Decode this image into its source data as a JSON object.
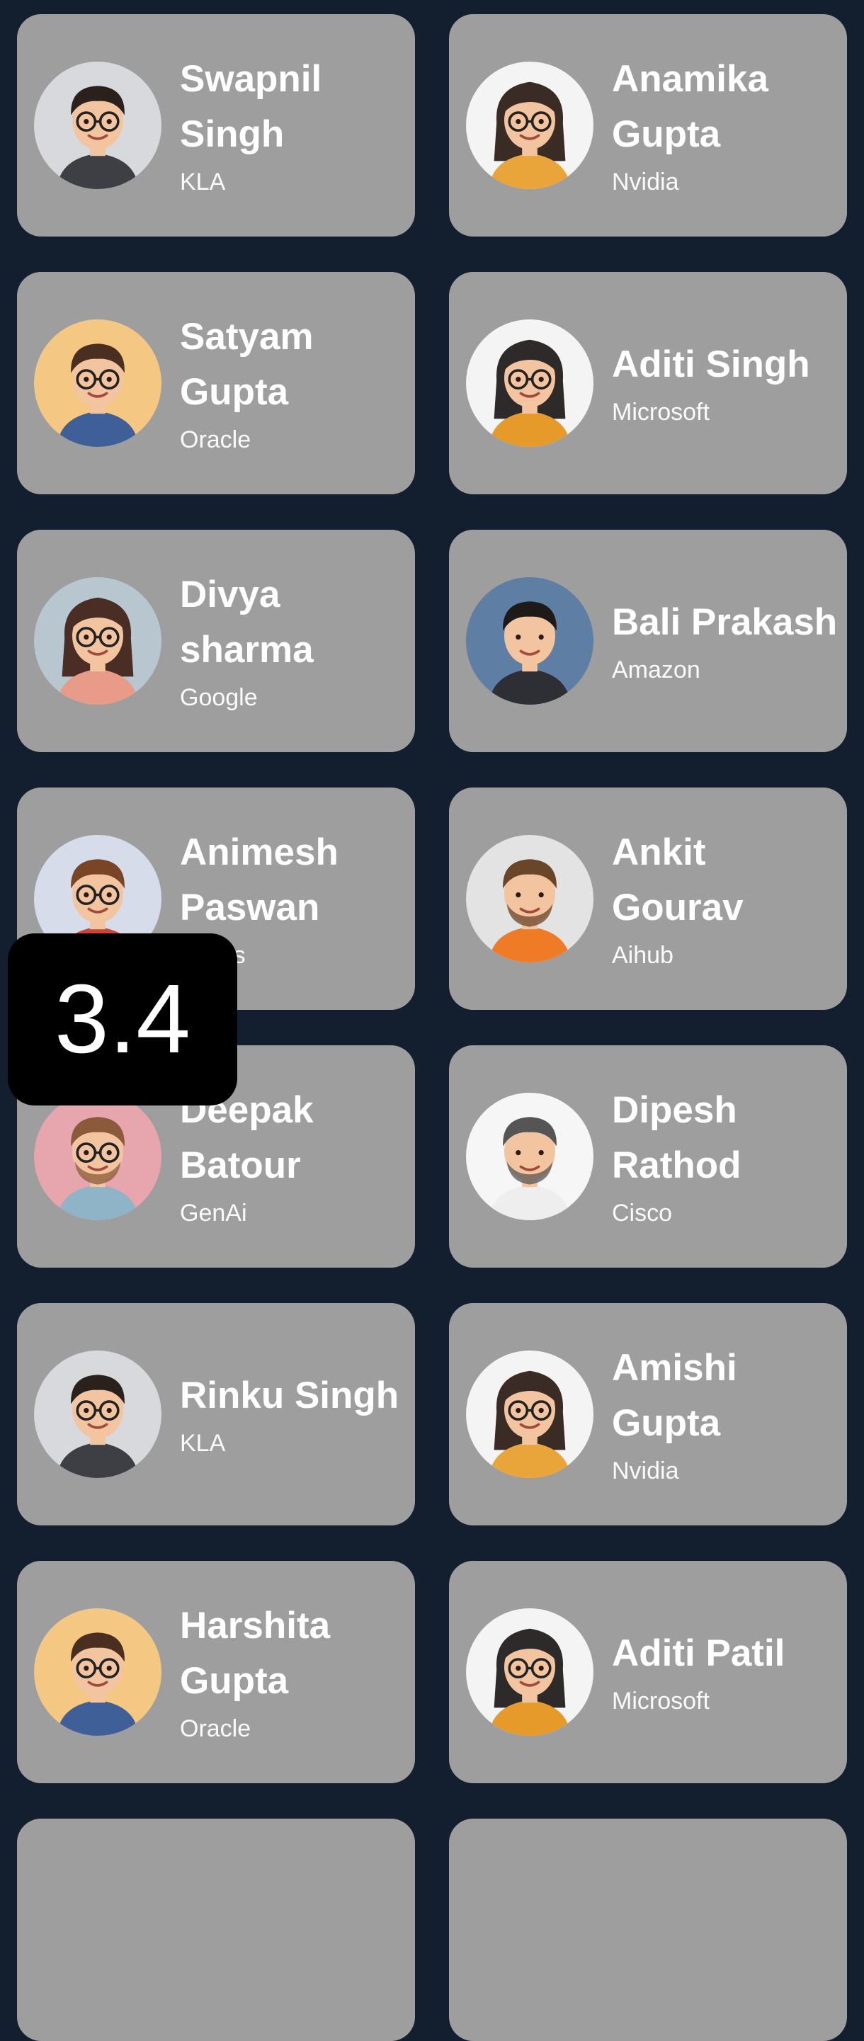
{
  "colors": {
    "background": "#131e2f",
    "card": "#9e9e9e",
    "text": "#ffffff",
    "toast": "#000000"
  },
  "cards": [
    {
      "name": "Swapnil Singh",
      "company": "KLA",
      "avatar": "businessman-avatar",
      "avatar_bg": "#d7d9dc"
    },
    {
      "name": "Anamika Gupta",
      "company": "Nvidia",
      "avatar": "girl-glasses-avatar",
      "avatar_bg": "#f4f4f4"
    },
    {
      "name": "Satyam Gupta",
      "company": "Oracle",
      "avatar": "man-glasses-avatar",
      "avatar_bg": "#f4c783"
    },
    {
      "name": "Aditi Singh",
      "company": "Microsoft",
      "avatar": "woman-round-glasses-avatar",
      "avatar_bg": "#f4f4f4"
    },
    {
      "name": "Divya sharma",
      "company": "Google",
      "avatar": "woman-short-hair-avatar",
      "avatar_bg": "#b8c6cf"
    },
    {
      "name": "Bali Prakash",
      "company": "Amazon",
      "avatar": "man-hoodie-avatar",
      "avatar_bg": "#5e7ea3"
    },
    {
      "name": "Animesh Paswan",
      "company": "Zdocs",
      "avatar": "man-curly-glasses-avatar",
      "avatar_bg": "#d6dcea"
    },
    {
      "name": "Ankit Gourav",
      "company": "Aihub",
      "avatar": "man-beard-avatar",
      "avatar_bg": "#e3e3e3"
    },
    {
      "name": "Deepak Batour",
      "company": "GenAi",
      "avatar": "man-goatee-glasses-avatar",
      "avatar_bg": "#e7a6ad"
    },
    {
      "name": "Dipesh Rathod",
      "company": "Cisco",
      "avatar": "man-spiky-hair-avatar",
      "avatar_bg": "#f6f6f6"
    },
    {
      "name": "Rinku Singh",
      "company": "KLA",
      "avatar": "businessman-avatar",
      "avatar_bg": "#d7d9dc"
    },
    {
      "name": "Amishi Gupta",
      "company": "Nvidia",
      "avatar": "girl-glasses-avatar",
      "avatar_bg": "#f4f4f4"
    },
    {
      "name": "Harshita Gupta",
      "company": "Oracle",
      "avatar": "man-glasses-avatar",
      "avatar_bg": "#f4c783"
    },
    {
      "name": "Aditi Patil",
      "company": "Microsoft",
      "avatar": "woman-round-glasses-avatar",
      "avatar_bg": "#f4f4f4"
    }
  ],
  "toast": {
    "text": "3.4"
  }
}
